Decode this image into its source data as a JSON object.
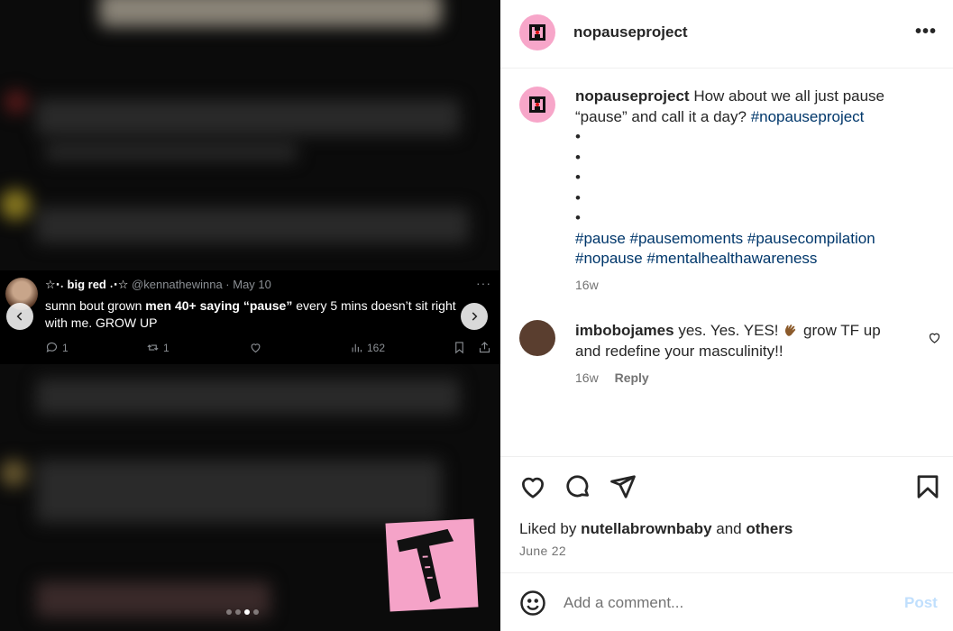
{
  "tweet": {
    "name": "☆⋅˖ big red ˖⋅☆",
    "handle": "@kennathewinna · May 10",
    "text_pre": "sumn bout grown ",
    "text_b1": "men 40+ saying “pause”",
    "text_post": " every 5 mins doesn’t sit right with me. GROW UP",
    "replies": "1",
    "retweets": "1",
    "views": "162"
  },
  "carousel": {
    "slides": 4,
    "active": 2
  },
  "post": {
    "username": "nopauseproject",
    "caption_main": "How about we all just pause “pause” and call it a day?",
    "caption_tag1": "#nopauseproject",
    "bullets": [
      "•",
      "•",
      "•",
      "•",
      "•"
    ],
    "hashtags": "#pause #pausemoments #pausecompilation #nopause #mentalhealthawareness",
    "caption_time": "16w",
    "liked_by_prefix": "Liked by",
    "liked_by_user": "nutellabrownbaby",
    "liked_by_and": "and",
    "liked_by_others": "others",
    "date": "June 22"
  },
  "comment": {
    "username": "imbobojames",
    "text_before": "yes. Yes. YES!",
    "text_after": "grow TF up and redefine your masculinity!!",
    "time": "16w",
    "reply_label": "Reply"
  },
  "composer": {
    "placeholder": "Add a comment...",
    "post_label": "Post"
  },
  "icons": {
    "more": "more-icon",
    "like": "heart-icon",
    "comment": "comment-icon",
    "share": "paper-plane-icon",
    "save": "bookmark-icon",
    "emoji": "emoji-icon"
  },
  "colors": {
    "brand_pink": "#f7a6c9",
    "hashtag": "#00376b",
    "post_button_disabled": "#c0dffd"
  }
}
